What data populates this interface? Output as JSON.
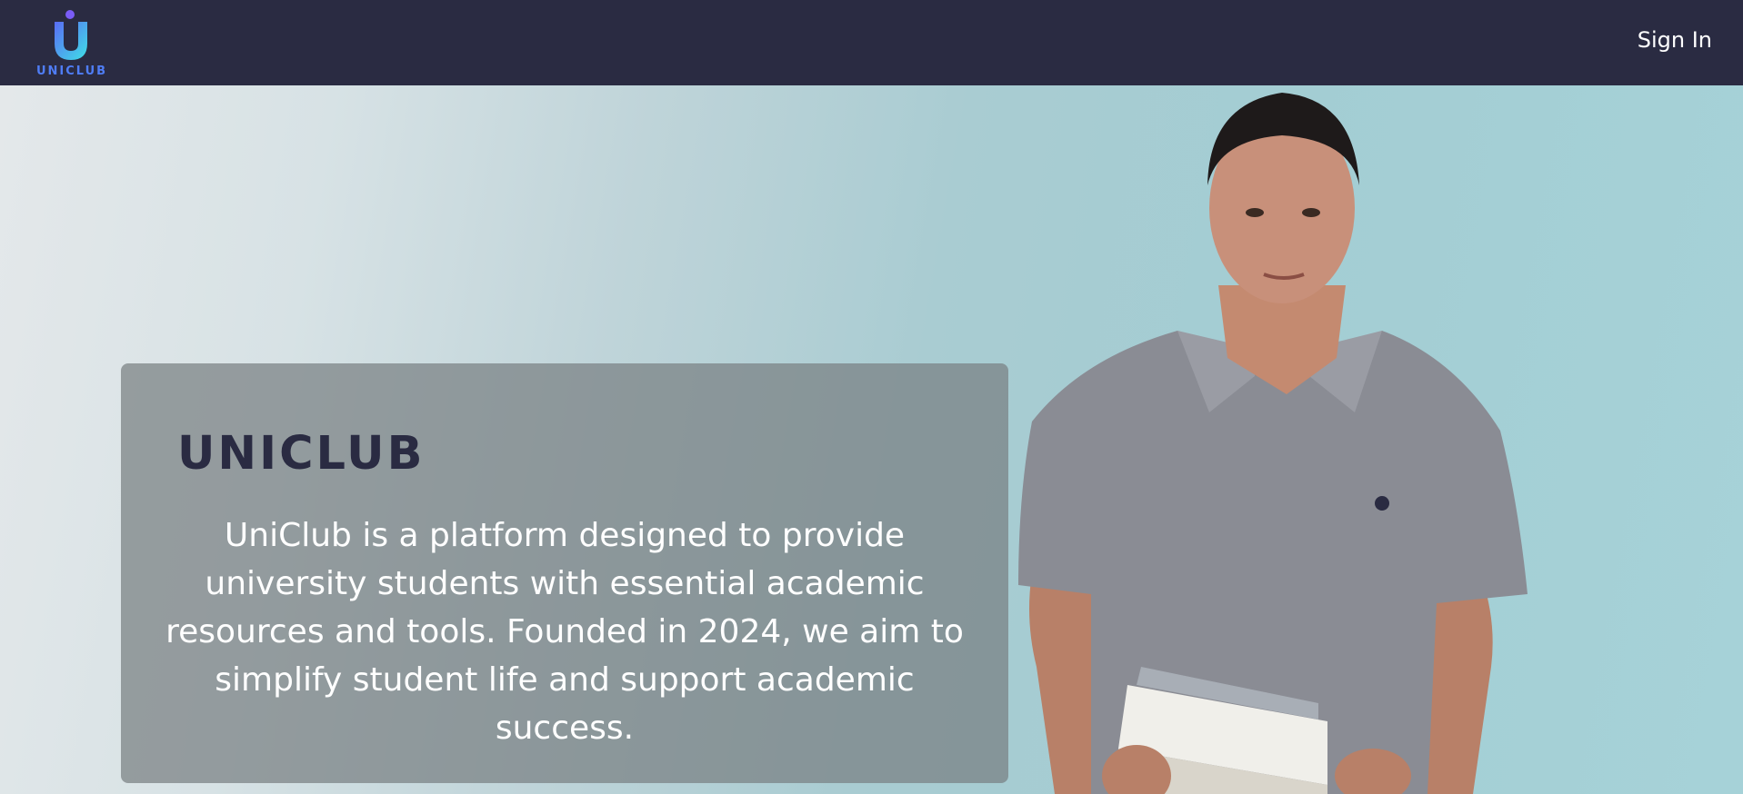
{
  "navbar": {
    "logo_text": "UNICLUB",
    "logo_icon": "uniclub-logo-icon",
    "signin_label": "Sign In"
  },
  "hero": {
    "title": "UNICLUB",
    "description": "UniClub is a platform designed to provide university students with essential academic resources and tools. Founded in 2024, we aim to simplify student life and support academic success.",
    "image": "student-holding-books-photo"
  },
  "colors": {
    "navbar_bg": "#2a2b42",
    "brand_blue": "#4f7df6",
    "brand_cyan": "#4fd6e6",
    "hero_bg": "#a6d2d8",
    "title_color": "#2a2b42"
  }
}
